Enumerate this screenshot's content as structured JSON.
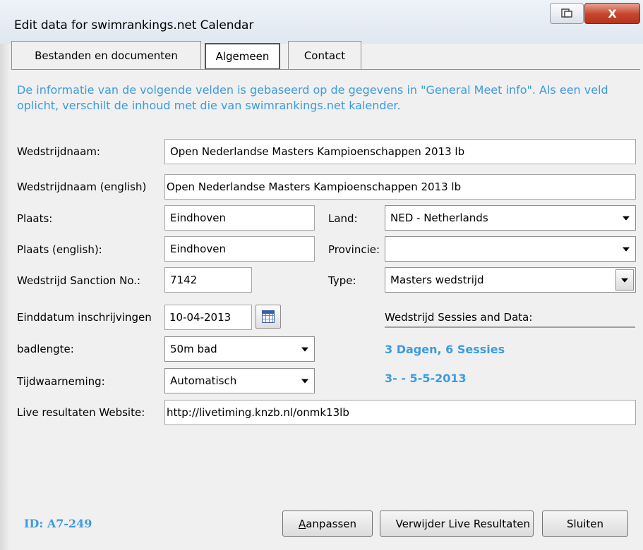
{
  "window": {
    "title": "Edit data for swimrankings.net Calendar",
    "close_label": "X"
  },
  "tabs": [
    {
      "label": "Bestanden en documenten",
      "active": false
    },
    {
      "label": "Algemeen",
      "active": true
    },
    {
      "label": "Contact",
      "active": false
    }
  ],
  "info_text": "De informatie van de volgende velden is gebaseerd op de gegevens in \"General Meet info\". Als een veld oplicht, verschilt de inhoud met die van swimrankings.net kalender.",
  "fields": {
    "wedstrijdnaam": {
      "label": "Wedstrijdnaam:",
      "value": "Open Nederlandse Masters Kampioenschappen 2013 lb"
    },
    "wedstrijdnaam_en": {
      "label": "Wedstrijdnaam (english)",
      "value": "Open Nederlandse Masters Kampioenschappen 2013 lb"
    },
    "plaats": {
      "label": "Plaats:",
      "value": "Eindhoven"
    },
    "plaats_en": {
      "label": "Plaats (english):",
      "value": "Eindhoven"
    },
    "sanction": {
      "label": "Wedstrijd Sanction No.:",
      "value": "7142"
    },
    "einddatum": {
      "label": "Einddatum inschrijvingen",
      "value": "10-04-2013"
    },
    "badlengte": {
      "label": "badlengte:",
      "value": "50m bad"
    },
    "tijdwaarneming": {
      "label": "Tijdwaarneming:",
      "value": "Automatisch"
    },
    "live": {
      "label": "Live resultaten Website:",
      "value": "http://livetiming.knzb.nl/onmk13lb"
    },
    "land": {
      "label": "Land:",
      "value": "NED - Netherlands"
    },
    "provincie": {
      "label": "Provincie:",
      "value": ""
    },
    "type": {
      "label": "Type:",
      "value": "Masters wedstrijd"
    }
  },
  "sessions": {
    "header": "Wedstrijd Sessies and Data:",
    "summary": "3 Dagen, 6 Sessies",
    "dates": "3- - 5-5-2013"
  },
  "footer": {
    "id": "ID: A7-249",
    "btn_aanpassen": "Aanpassen",
    "btn_verwijder": "Verwijder Live Resultaten",
    "btn_sluiten": "Sluiten"
  },
  "colors": {
    "accent": "#3c9be0",
    "close": "#c5432c"
  }
}
